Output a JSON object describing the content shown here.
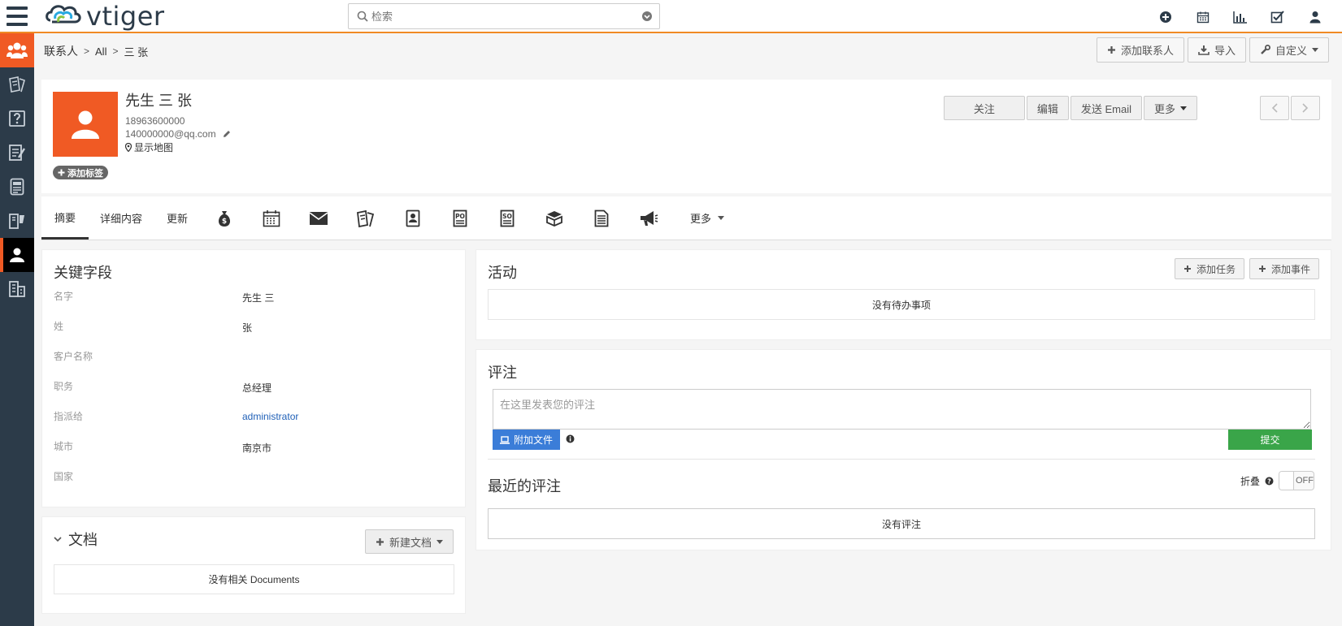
{
  "app": {
    "logo_text": "vtiger"
  },
  "search": {
    "placeholder": "检索"
  },
  "top_icons": [
    "plus-circle-icon",
    "calendar-icon",
    "bar-chart-icon",
    "checkbox-icon",
    "user-icon"
  ],
  "sidebar": {
    "items": [
      "contacts-icon",
      "tickets-icon",
      "faq-icon",
      "quotes-icon",
      "invoice-icon",
      "products-icon",
      "contact-active-icon",
      "organizations-icon"
    ]
  },
  "breadcrumb": {
    "module": "联系人",
    "filter": "All",
    "record": "三 张"
  },
  "header_buttons": {
    "add_contact": "添加联系人",
    "import": "导入",
    "customize": "自定义"
  },
  "record": {
    "name": "先生 三 张",
    "phone": "18963600000",
    "email": "140000000@qq.com",
    "map": "显示地图",
    "add_tag": "添加标签",
    "actions": {
      "follow": "关注",
      "edit": "编辑",
      "send_email": "发送 Email",
      "more": "更多"
    }
  },
  "tabs": {
    "summary": "摘要",
    "details": "详细内容",
    "updates": "更新",
    "icons": [
      "opportunity-icon",
      "calendar-icon",
      "email-icon",
      "tickets-icon",
      "contact-card-icon",
      "po-icon",
      "so-icon",
      "products-icon",
      "documents-icon",
      "campaign-icon"
    ],
    "more": "更多"
  },
  "key_fields": {
    "title": "关键字段",
    "rows": [
      {
        "label": "名字",
        "value": "先生 三"
      },
      {
        "label": "姓",
        "value": "张"
      },
      {
        "label": "客户名称",
        "value": ""
      },
      {
        "label": "职务",
        "value": "总经理"
      },
      {
        "label": "指派给",
        "value": "administrator"
      },
      {
        "label": "城市",
        "value": "南京市"
      },
      {
        "label": "国家",
        "value": ""
      }
    ]
  },
  "documents": {
    "title": "文档",
    "new_button": "新建文档",
    "empty": "没有相关 Documents"
  },
  "activities": {
    "title": "活动",
    "add_task": "添加任务",
    "add_event": "添加事件",
    "empty": "没有待办事项"
  },
  "comments": {
    "title": "评注",
    "placeholder": "在这里发表您的评注",
    "attach": "附加文件",
    "submit": "提交",
    "recent_title": "最近的评注",
    "collapse_label": "折叠",
    "toggle_state": "OFF",
    "empty": "没有评注"
  },
  "colors": {
    "accent": "#f05a24",
    "topbar_border": "#f08a24",
    "sidebar": "#2c3b49",
    "attach": "#3b7dd8",
    "submit": "#3aa549",
    "link": "#2161b8"
  }
}
